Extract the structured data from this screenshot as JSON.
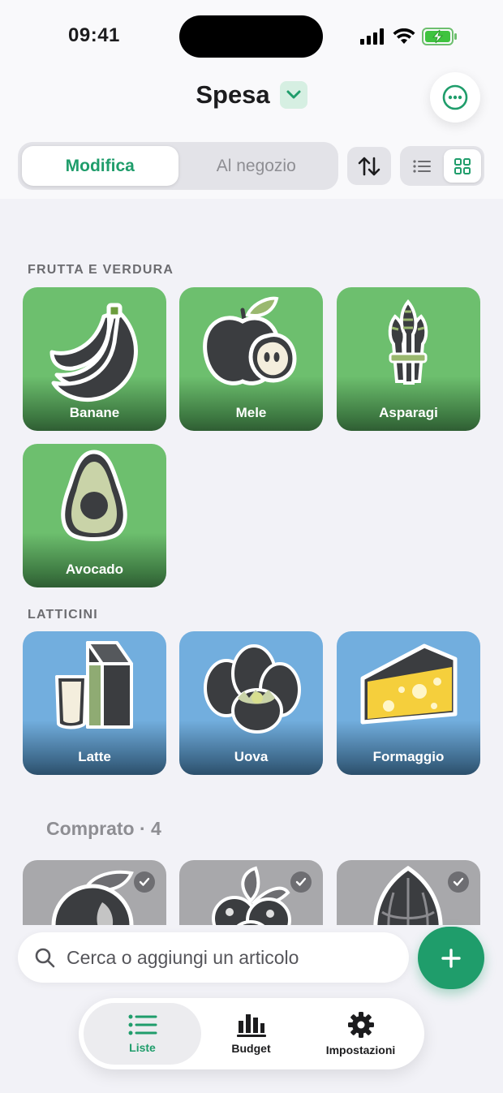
{
  "status_bar": {
    "time": "09:41"
  },
  "header": {
    "title": "Spesa",
    "mode_tabs": [
      {
        "label": "Modifica",
        "selected": true
      },
      {
        "label": "Al negozio",
        "selected": false
      }
    ],
    "view_mode": "grid"
  },
  "sections": [
    {
      "title": "FRUTTA E VERDURA",
      "color": "green",
      "items": [
        {
          "label": "Banane",
          "icon": "banana-icon"
        },
        {
          "label": "Mele",
          "icon": "apple-icon"
        },
        {
          "label": "Asparagi",
          "icon": "asparagus-icon"
        },
        {
          "label": "Avocado",
          "icon": "avocado-icon"
        }
      ]
    },
    {
      "title": "LATTICINI",
      "color": "blue",
      "items": [
        {
          "label": "Latte",
          "icon": "milk-icon"
        },
        {
          "label": "Uova",
          "icon": "eggs-icon"
        },
        {
          "label": "Formaggio",
          "icon": "cheese-icon"
        }
      ]
    }
  ],
  "bought": {
    "title": "Comprato · 4",
    "visible_icons": [
      "plum-icon",
      "blueberries-icon",
      "artichoke-icon"
    ]
  },
  "search": {
    "placeholder": "Cerca o aggiungi un articolo"
  },
  "tabbar": {
    "items": [
      {
        "label": "Liste",
        "selected": true
      },
      {
        "label": "Budget",
        "selected": false
      },
      {
        "label": "Impostazioni",
        "selected": false
      }
    ]
  },
  "colors": {
    "accent": "#1f9d6b",
    "produce_tile": "#6dbf6e",
    "dairy_tile": "#72aede",
    "bought_tile": "#a8a8ab"
  }
}
